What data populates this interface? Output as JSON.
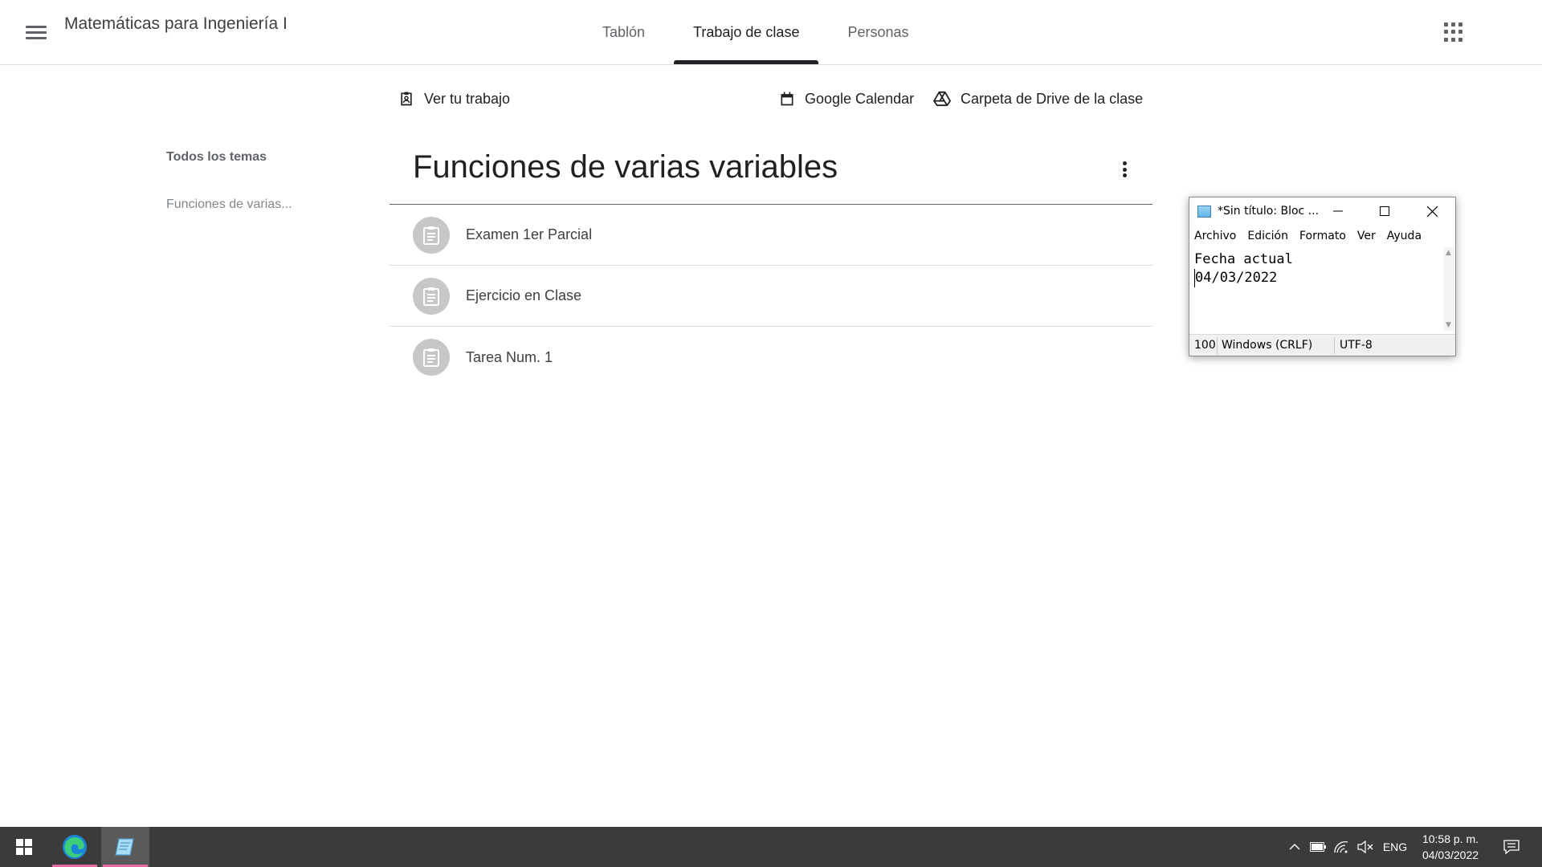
{
  "header": {
    "class_title": "Matemáticas para Ingeniería I",
    "tabs": [
      {
        "label": "Tablón",
        "active": false
      },
      {
        "label": "Trabajo de clase",
        "active": true
      },
      {
        "label": "Personas",
        "active": false
      }
    ]
  },
  "toolbar": {
    "view_work": "Ver tu trabajo",
    "calendar": "Google Calendar",
    "drive": "Carpeta de Drive de la clase"
  },
  "topics": {
    "all": "Todos los temas",
    "items": [
      "Funciones de varias..."
    ]
  },
  "section": {
    "title": "Funciones de varias variables",
    "assignments": [
      "Examen 1er Parcial",
      "Ejercicio en Clase",
      "Tarea Num. 1"
    ]
  },
  "notepad": {
    "title": "*Sin título: Bloc ...",
    "menu": [
      "Archivo",
      "Edición",
      "Formato",
      "Ver",
      "Ayuda"
    ],
    "line1": "Fecha actual",
    "line2": "04/03/2022",
    "zoom": "100",
    "line_ending": "Windows (CRLF)",
    "encoding": "UTF-8"
  },
  "taskbar": {
    "language": "ENG",
    "time": "10:58 p. m.",
    "date": "04/03/2022"
  },
  "colors": {
    "text_primary": "#202124",
    "text_secondary": "#5f6368",
    "divider": "#dadce0",
    "assignment_icon_bg": "#c7c7c7",
    "taskbar_bg": "#3b3b3b",
    "taskbar_indicator": "#e86aa3"
  }
}
